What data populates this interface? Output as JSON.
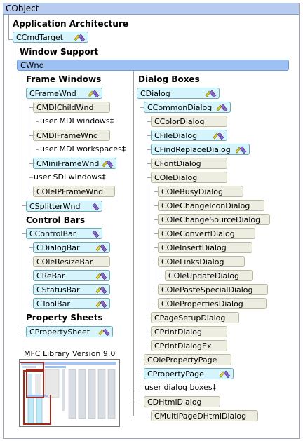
{
  "root": "CObject",
  "headers": {
    "app_arch": "Application Architecture",
    "window_support": "Window Support",
    "frame_windows": "Frame Windows",
    "dialog_boxes": "Dialog Boxes",
    "control_bars": "Control Bars",
    "property_sheets": "Property Sheets"
  },
  "ccmdtarget": "CCmdTarget",
  "cwnd": "CWnd",
  "left": {
    "cframewnd": "CFrameWnd",
    "cmdichildwnd": "CMDIChildWnd",
    "user_mdi_windows": "user MDI windows‡",
    "cmdiframewnd": "CMDIFrameWnd",
    "user_mdi_workspaces": "user MDI workspaces‡",
    "cminiframewnd": "CMiniFrameWnd",
    "user_sdi_windows": "user SDI windows‡",
    "coleipframewnd": "COleIPFrameWnd",
    "csplitterwnd": "CSplitterWnd",
    "ccontrolbar": "CControlBar",
    "cdialogbar": "CDialogBar",
    "coleresizebar": "COleResizeBar",
    "crebar": "CReBar",
    "cstatusbar": "CStatusBar",
    "ctoolbar": "CToolBar",
    "cpropertysheet": "CPropertySheet"
  },
  "right": {
    "cdialog": "CDialog",
    "ccommondialog": "CCommonDialog",
    "ccolordialog": "CColorDialog",
    "cfiledialog": "CFileDialog",
    "cfindreplacedialog": "CFindReplaceDialog",
    "cfontdialog": "CFontDialog",
    "coledialog": "COleDialog",
    "colebusydialog": "COleBusyDialog",
    "colechangeicondialog": "COleChangeIconDialog",
    "colechangesourcedialog": "COleChangeSourceDialog",
    "coleconvertdialog": "COleConvertDialog",
    "coleinsertdialog": "COleInsertDialog",
    "colelinksdialog": "COleLinksDialog",
    "coleupdatedialog": "COleUpdateDialog",
    "colepastespecialdialog": "COlePasteSpecialDialog",
    "colepropertiesdialog": "COlePropertiesDialog",
    "cpagesetupdialog": "CPageSetupDialog",
    "cprintdialog": "CPrintDialog",
    "cprintdialogex": "CPrintDialogEx",
    "colepropertypage": "COlePropertyPage",
    "cpropertypage": "CPropertyPage",
    "user_dialog_boxes": "user dialog boxes‡",
    "chtmldialog": "CDHtmlDialog",
    "cmultipagedhtmldialog": "CMultiPageDHtmlDialog"
  },
  "mini_title": "MFC Library Version 9.0",
  "icon_names": [
    "supports-run-time-class-icon"
  ],
  "colors": {
    "class_box": "#d6f4fb",
    "tan_box": "#eeede1",
    "header_bar": "#b7ccee",
    "highlight": "#9cc1f2"
  }
}
